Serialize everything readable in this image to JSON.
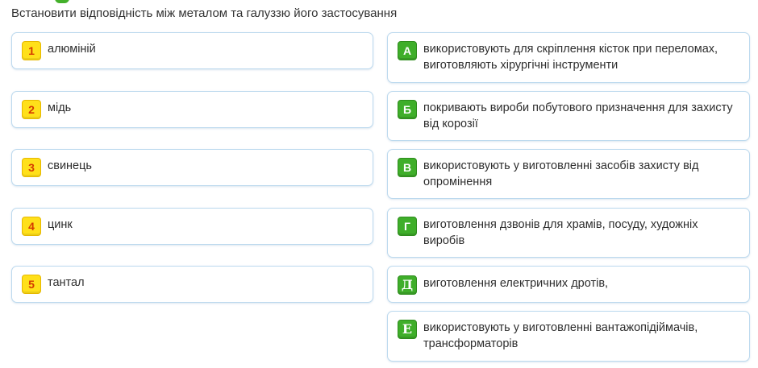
{
  "question": "Встановити відповідність між металом та галуззю його застосування",
  "colors": {
    "number_badge_bg": "#ffe01a",
    "number_badge_text": "#d43b00",
    "letter_badge_bg": "#3fae2a",
    "card_border": "#bcd9ee"
  },
  "left_items": [
    {
      "badge": "1",
      "text": "алюміній"
    },
    {
      "badge": "2",
      "text": "мідь"
    },
    {
      "badge": "3",
      "text": "свинець"
    },
    {
      "badge": "4",
      "text": "цинк"
    },
    {
      "badge": "5",
      "text": "тантал"
    }
  ],
  "right_items": [
    {
      "badge": "А",
      "text": "використовують для скріплення кісток при переломах, виготовляють хірургічні інструменти"
    },
    {
      "badge": "Б",
      "text": "покривають вироби побутового призначення для захисту від корозії"
    },
    {
      "badge": "В",
      "text": "використовують у виготовленні засобів захисту від опромінення"
    },
    {
      "badge": "Г",
      "text": "виготовлення дзвонів для храмів, посуду, художніх виробів"
    },
    {
      "badge": "Д",
      "text": "виготовлення електричних дротів,"
    },
    {
      "badge": "Е",
      "text": "використовують у виготовленні вантажопідіймачів, трансформаторів"
    }
  ]
}
